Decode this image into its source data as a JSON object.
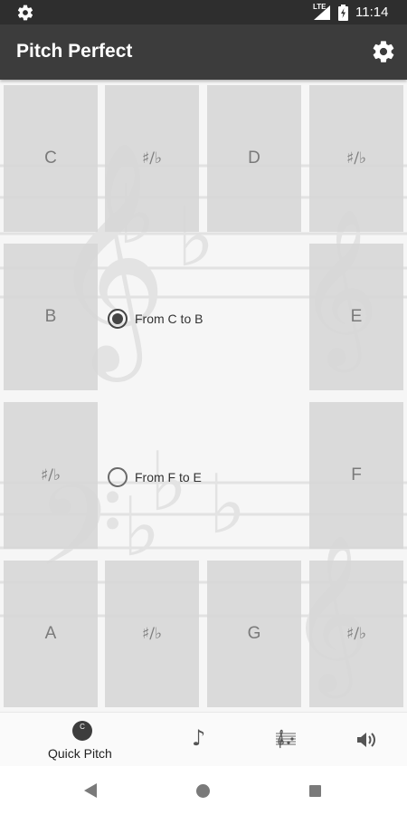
{
  "status_bar": {
    "network": "LTE",
    "time": "11:14"
  },
  "app_bar": {
    "title": "Pitch Perfect"
  },
  "keys": {
    "c": "C",
    "d": "D",
    "e": "E",
    "f": "F",
    "g": "G",
    "a": "A",
    "b": "B",
    "c_sharp": "♯/♭",
    "d_sharp": "♯/♭",
    "f_sharp": "♯/♭",
    "g_sharp": "♯/♭",
    "a_sharp": "♯/♭"
  },
  "range_options": [
    {
      "label": "From C to B",
      "selected": true
    },
    {
      "label": "From F to E",
      "selected": false
    }
  ],
  "bottom_nav": {
    "quick_pitch_badge": "C",
    "quick_pitch_label": "Quick Pitch",
    "note_icon": "♪",
    "icons": [
      "music-note-icon",
      "staff-icon",
      "volume-icon"
    ]
  },
  "colors": {
    "status_bar": "#2e2e2e",
    "app_bar": "#3c3c3c",
    "key": "#d6d6d6",
    "key_text": "#7a7a7a"
  }
}
